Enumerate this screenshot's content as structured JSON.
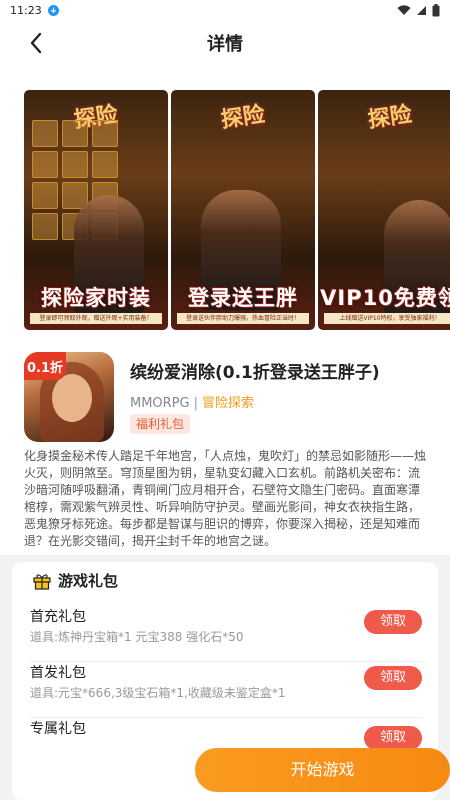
{
  "status_bar": {
    "time": "11:23"
  },
  "header": {
    "title": "详情"
  },
  "screenshots": [
    {
      "caption": "探险家时装",
      "banner": "登录即可领取外观，赠送外观+实用装备！"
    },
    {
      "caption": "登录送王胖",
      "banner": "登录送伙伴胖助刀爆强，热血冒险正当时！"
    },
    {
      "caption": "VIP10免费领",
      "banner": "上线赠送VIP10特权，享受独家福利！"
    }
  ],
  "game": {
    "name": "缤纷爱消除(0.1折登录送王胖子)",
    "genre": "MMORPG",
    "category": "冒险探索",
    "gift_tag": "福利礼包",
    "icon_badge": "0.1折",
    "description": "化身摸金秘术传人踏足千年地宫，「人点烛，鬼吹灯」的禁忌如影随形——烛火灭，则阴煞至。穹顶星图为钥，星轨变幻藏入口玄机。前路机关密布：流沙暗河随呼吸翻涌，青铜闸门应月相开合，石壁符文隐生门密码。直面寒潭棺椁，需观紫气辨灵性、听异响防守护灵。壁画光影间，神女衣袂指生路，恶鬼獠牙标死途。每步都是智谋与胆识的博弈，你要深入揭秘，还是知难而退？在光影交错间，揭开尘封千年的地宫之谜。"
  },
  "gift_section": {
    "title": "游戏礼包",
    "items": [
      {
        "title": "首充礼包",
        "detail": "道具:炼神丹宝箱*1 元宝388 强化石*50",
        "button": "领取"
      },
      {
        "title": "首发礼包",
        "detail": "道具:元宝*666,3级宝石箱*1,收藏级未鉴定盒*1",
        "button": "领取"
      },
      {
        "title": "专属礼包",
        "detail": "",
        "button": "领取"
      }
    ]
  },
  "start_button": "开始游戏"
}
